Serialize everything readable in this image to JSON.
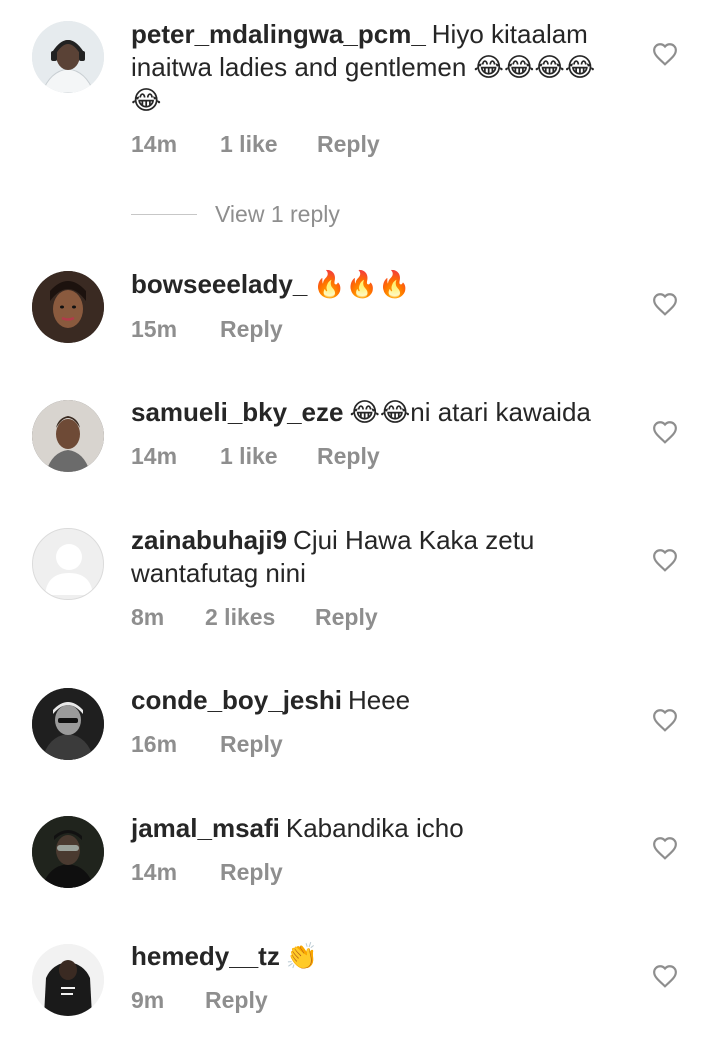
{
  "comments": [
    {
      "username": "peter_mdalingwa_pcm_",
      "text": "Hiyo kitaalam inaitwa ladies and gentlemen 😂😂😂😂😂",
      "time": "14m",
      "likes": "1 like",
      "reply": "Reply",
      "view_replies": "View 1 reply",
      "avatar": "headphones-man-avatar"
    },
    {
      "username": "bowseeelady_",
      "text": "🔥🔥🔥",
      "time": "15m",
      "likes": "",
      "reply": "Reply",
      "avatar": "woman-avatar"
    },
    {
      "username": "samueli_bky_eze",
      "text": "😂😂ni atari kawaida",
      "time": "14m",
      "likes": "1 like",
      "reply": "Reply",
      "avatar": "young-man-avatar"
    },
    {
      "username": "zainabuhaji9",
      "text": "Cjui Hawa Kaka zetu wantafutag nini",
      "time": "8m",
      "likes": "2 likes",
      "reply": "Reply",
      "avatar": "default-avatar"
    },
    {
      "username": "conde_boy_jeshi",
      "text": "Heee",
      "time": "16m",
      "likes": "",
      "reply": "Reply",
      "avatar": "bw-man-avatar"
    },
    {
      "username": "jamal_msafi",
      "text": "Kabandika icho",
      "time": "14m",
      "likes": "",
      "reply": "Reply",
      "avatar": "dark-man-avatar"
    },
    {
      "username": "hemedy__tz",
      "text": "👏",
      "time": "9m",
      "likes": "",
      "reply": "Reply",
      "avatar": "africa-hoodie-avatar"
    }
  ],
  "colors": {
    "text": "#262626",
    "secondary": "#8e8e8e",
    "divider": "#c7c7c7"
  },
  "icons": {
    "like": "heart-outline-icon"
  }
}
